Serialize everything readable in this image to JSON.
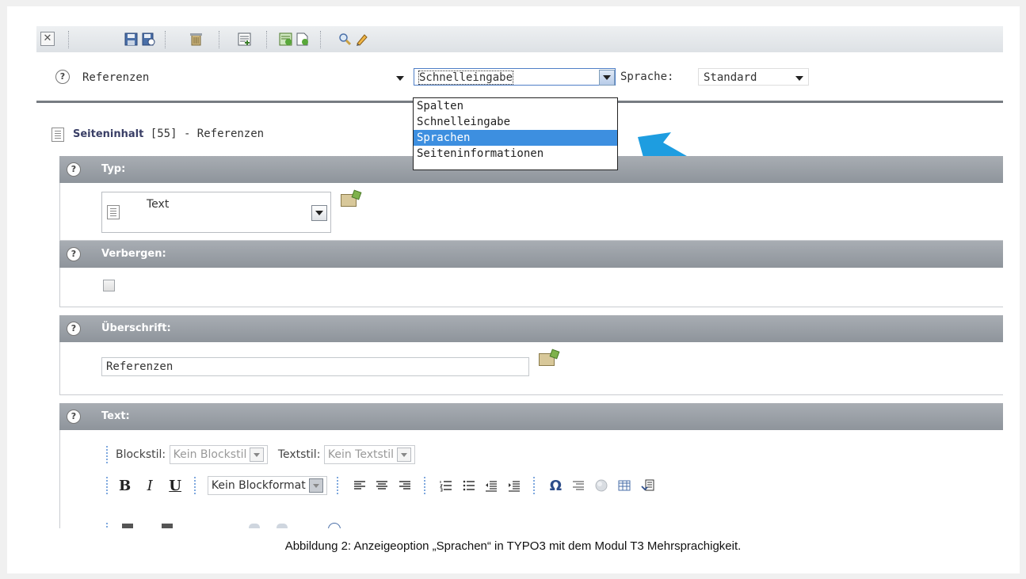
{
  "toolbar": {
    "icons": [
      "close-icon",
      "save-icon",
      "save-view-icon",
      "delete-icon",
      "new-record-icon",
      "new-content-icon",
      "new-page-icon",
      "search-icon",
      "edit-icon"
    ]
  },
  "selector": {
    "page_select_value": "Referenzen",
    "view_select_value": "Schnelleingabe",
    "language_label": "Sprache:",
    "language_value": "Standard",
    "view_options": [
      "Spalten",
      "Schnelleingabe",
      "Sprachen",
      "Seiteninformationen"
    ],
    "selected_option": "Sprachen"
  },
  "record": {
    "type_label": "Seiteninhalt",
    "id": "[55]",
    "title": "- Referenzen"
  },
  "sections": {
    "typ": {
      "label": "Typ:",
      "value": "Text"
    },
    "verbergen": {
      "label": "Verbergen:"
    },
    "ueberschrift": {
      "label": "Überschrift:",
      "value": "Referenzen"
    },
    "text": {
      "label": "Text:"
    }
  },
  "rte": {
    "blockstil_label": "Blockstil:",
    "blockstil_value": "Kein Blockstil",
    "textstil_label": "Textstil:",
    "textstil_value": "Kein Textstil",
    "blockformat_value": "Kein Blockformat",
    "bold": "B",
    "italic": "I",
    "underline": "U",
    "omega": "Ω"
  },
  "colors": {
    "section_header": "#9aa0a6",
    "highlight": "#3d8fe0",
    "arrow": "#1e9de0"
  },
  "caption": "Abbildung 2: Anzeigeoption „Sprachen“ in TYPO3 mit dem Modul T3 Mehrsprachigkeit."
}
